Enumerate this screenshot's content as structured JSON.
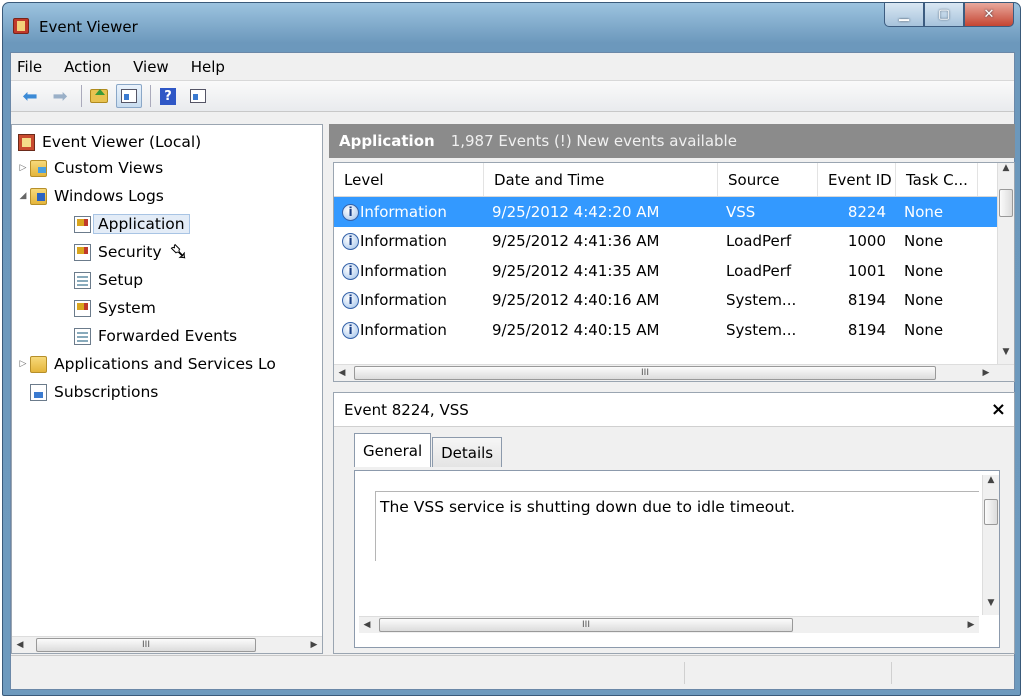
{
  "window": {
    "title": "Event Viewer"
  },
  "menu": [
    "File",
    "Action",
    "View",
    "Help"
  ],
  "tree": {
    "root": "Event Viewer (Local)",
    "custom_views": "Custom Views",
    "windows_logs": "Windows Logs",
    "application": "Application",
    "security": "Security",
    "setup": "Setup",
    "system": "System",
    "forwarded": "Forwarded Events",
    "apps_services": "Applications and Services Lo",
    "subscriptions": "Subscriptions"
  },
  "header": {
    "name": "Application",
    "info": "1,987 Events (!) New events available"
  },
  "columns": [
    "Level",
    "Date and Time",
    "Source",
    "Event ID",
    "Task C..."
  ],
  "rows": [
    {
      "level": "Information",
      "date": "9/25/2012 4:42:20 AM",
      "source": "VSS",
      "id": "8224",
      "task": "None"
    },
    {
      "level": "Information",
      "date": "9/25/2012 4:41:36 AM",
      "source": "LoadPerf",
      "id": "1000",
      "task": "None"
    },
    {
      "level": "Information",
      "date": "9/25/2012 4:41:35 AM",
      "source": "LoadPerf",
      "id": "1001",
      "task": "None"
    },
    {
      "level": "Information",
      "date": "9/25/2012 4:40:16 AM",
      "source": "System...",
      "id": "8194",
      "task": "None"
    },
    {
      "level": "Information",
      "date": "9/25/2012 4:40:15 AM",
      "source": "System...",
      "id": "8194",
      "task": "None"
    }
  ],
  "detail": {
    "title": "Event 8224, VSS",
    "tabs": [
      "General",
      "Details"
    ],
    "message": "The VSS service is shutting down due to idle timeout."
  },
  "scroll_glyph": "III",
  "close_glyph": "×",
  "selection_color": "#3399ff"
}
